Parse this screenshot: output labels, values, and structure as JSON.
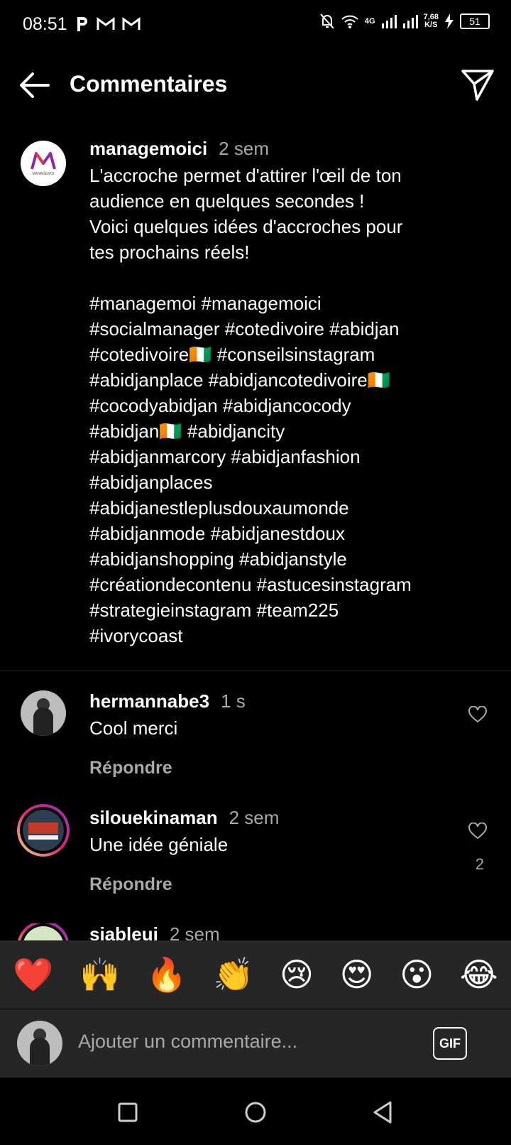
{
  "status": {
    "time": "08:51",
    "left_icons": [
      "p-icon",
      "gmail-icon",
      "gmail-icon"
    ],
    "network": "4G",
    "speed_value": "7,68",
    "speed_unit": "K/S",
    "battery": "51"
  },
  "header": {
    "title": "Commentaires"
  },
  "caption": {
    "username": "managemoici",
    "time": "2 sem",
    "avatar_text": "MANAGEMOI",
    "text_lines": [
      "L'accroche permet d'attirer l'œil de ton",
      "audience en quelques secondes !",
      "Voici quelques idées d'accroches pour",
      "tes prochains réels!"
    ],
    "hashtag_lines": [
      "#managemoi #managemoici",
      "#socialmanager #cotedivoire #abidjan",
      "#cotedivoire🇨🇮 #conseilsinstagram",
      "#abidjanplace #abidjancotedivoire🇨🇮",
      "#cocodyabidjan #abidjancocody",
      "#abidjan🇨🇮 #abidjancity",
      "#abidjanmarcory #abidjanfashion",
      "#abidjanplaces",
      "#abidjanestleplusdouxaumonde",
      "#abidjanmode #abidjanestdoux",
      "#abidjanshopping #abidjanstyle",
      "#créationdecontenu #astucesinstagram",
      "#strategieinstagram #team225",
      "#ivorycoast"
    ]
  },
  "comments": [
    {
      "username": "hermannabe3",
      "time": "1 s",
      "text": "Cool merci",
      "reply": "Répondre",
      "likes": ""
    },
    {
      "username": "silouekinaman",
      "time": "2 sem",
      "text": "Une idée géniale",
      "reply": "Répondre",
      "likes": "2"
    },
    {
      "username": "siableui",
      "time": "2 sem",
      "text": "",
      "reply": "",
      "likes": ""
    }
  ],
  "emojis": [
    "❤️",
    "🙌",
    "🔥",
    "👏",
    "😢",
    "😍",
    "😮",
    "😂"
  ],
  "input": {
    "placeholder": "Ajouter un commentaire...",
    "gif_label": "GIF"
  },
  "colors": {
    "background": "#000000",
    "secondary_text": "#a8a8a8",
    "panel": "#262626"
  }
}
